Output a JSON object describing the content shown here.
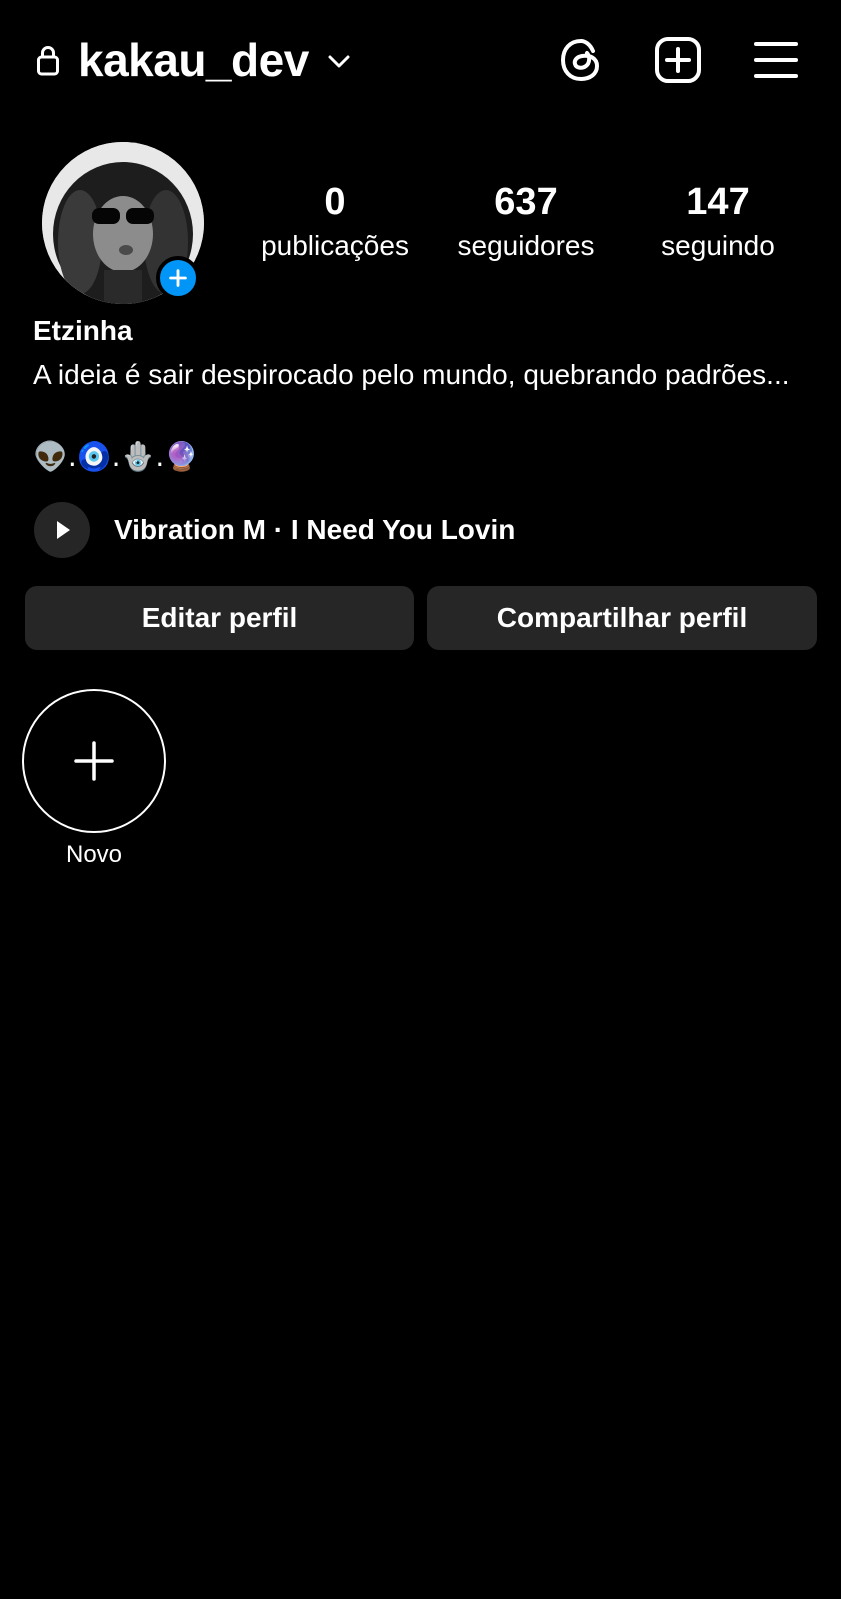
{
  "header": {
    "username": "kakau_dev",
    "icons": [
      "lock-icon",
      "chevron-down-icon",
      "threads-icon",
      "new-post-icon",
      "menu-icon"
    ]
  },
  "profile": {
    "display_name": "Etzinha",
    "bio": "A ideia é sair despirocado pelo mundo, quebrando padrões...",
    "bio_emojis": "👽.🧿.🪬.🔮",
    "stats": {
      "posts": {
        "value": "0",
        "label": "publicações"
      },
      "followers": {
        "value": "637",
        "label": "seguidores"
      },
      "following": {
        "value": "147",
        "label": "seguindo"
      }
    }
  },
  "music": {
    "label": "Vibration M · I Need You Lovin"
  },
  "actions": {
    "edit_label": "Editar perfil",
    "share_label": "Compartilhar perfil"
  },
  "highlights": {
    "new_label": "Novo"
  },
  "colors": {
    "background": "#000000",
    "text": "#ffffff",
    "button_bg": "#262626",
    "accent": "#0095f6"
  }
}
